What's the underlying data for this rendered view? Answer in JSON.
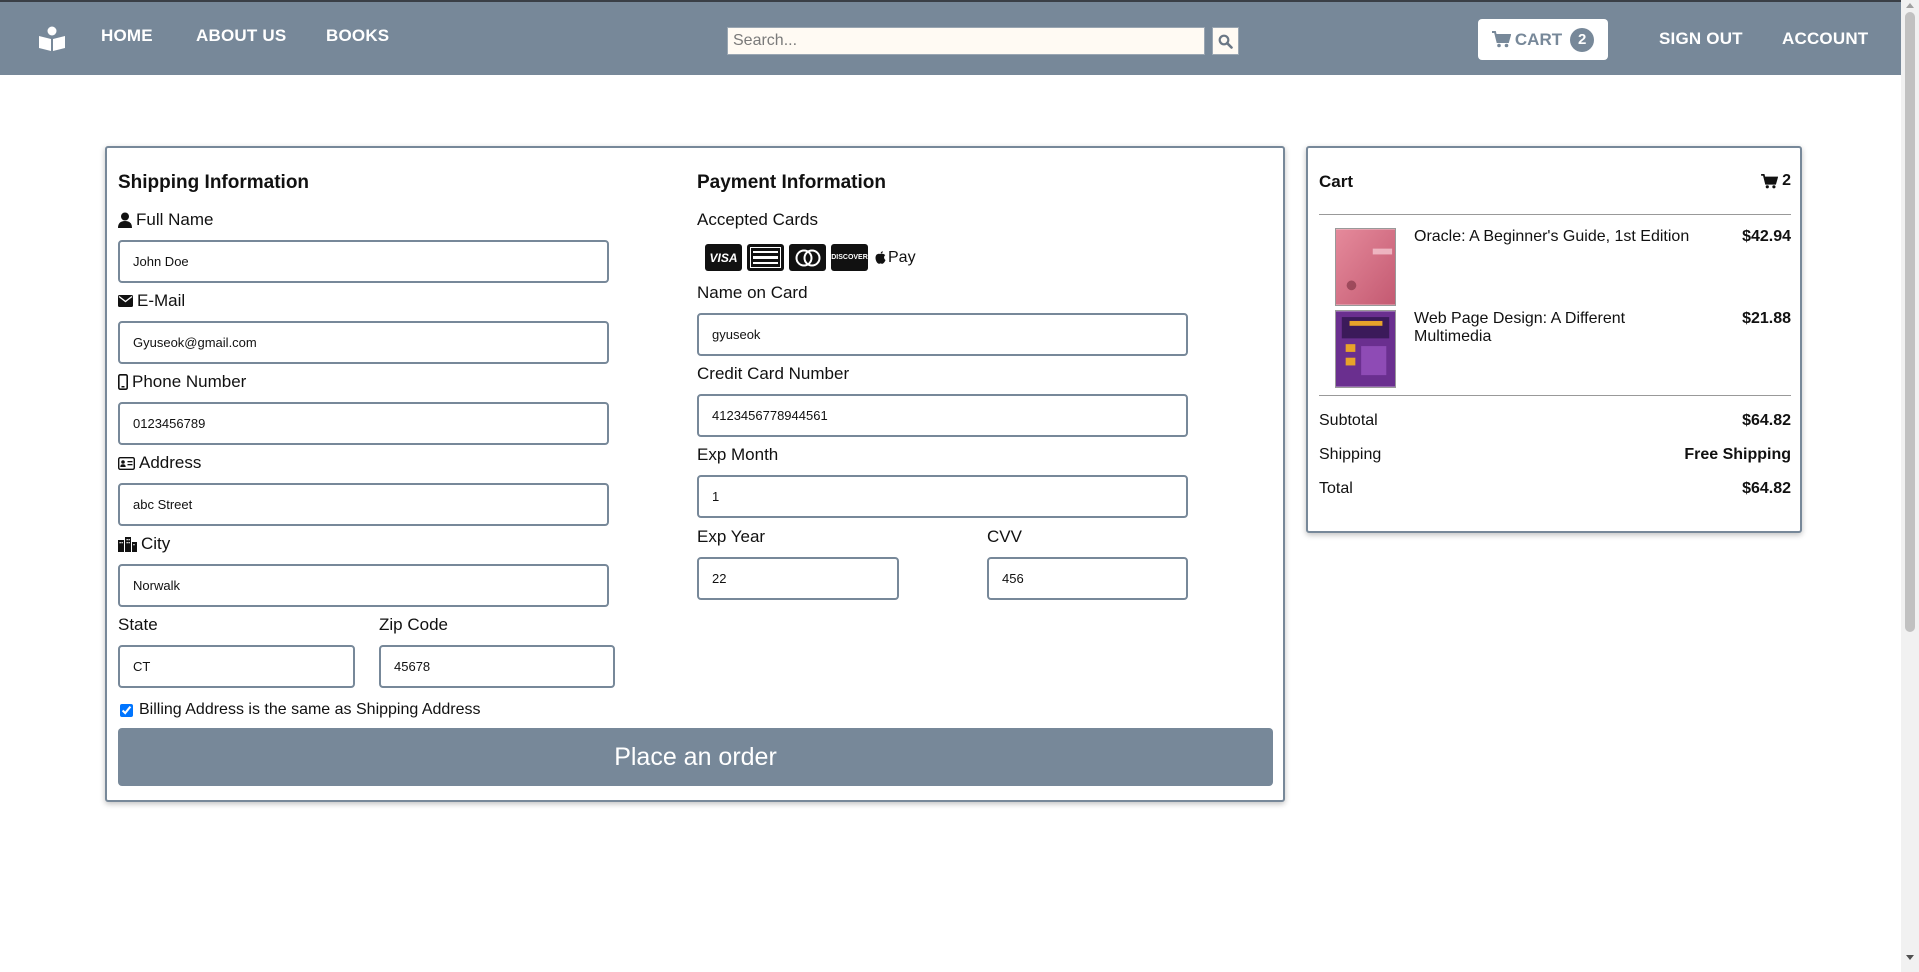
{
  "nav": {
    "home": "HOME",
    "about": "ABOUT US",
    "books": "BOOKS",
    "search_placeholder": "Search...",
    "cart_label": "CART",
    "cart_count": "2",
    "sign_out": "SIGN OUT",
    "account": "ACCOUNT"
  },
  "shipping": {
    "title": "Shipping Information",
    "full_name_label": "Full Name",
    "full_name_value": "John Doe",
    "email_label": "E-Mail",
    "email_value": "Gyuseok@gmail.com",
    "phone_label": "Phone Number",
    "phone_value": "0123456789",
    "address_label": "Address",
    "address_value": "abc Street",
    "city_label": "City",
    "city_value": "Norwalk",
    "state_label": "State",
    "state_value": "CT",
    "zip_label": "Zip Code",
    "zip_value": "45678",
    "billing_same_label": "Billing Address is the same as Shipping Address",
    "billing_same_checked": true
  },
  "payment": {
    "title": "Payment Information",
    "accepted_cards_label": "Accepted Cards",
    "cards": [
      "VISA",
      "AMEX",
      "MASTERCARD",
      "DISCOVER"
    ],
    "apple_pay": "Pay",
    "name_on_card_label": "Name on Card",
    "name_on_card_value": "gyuseok",
    "card_number_label": "Credit Card Number",
    "card_number_value": "4123456778944561",
    "exp_month_label": "Exp Month",
    "exp_month_value": "1",
    "exp_year_label": "Exp Year",
    "exp_year_value": "22",
    "cvv_label": "CVV",
    "cvv_value": "456"
  },
  "order_button": "Place an order",
  "cart": {
    "title": "Cart",
    "count": "2",
    "items": [
      {
        "title": "Oracle: A Beginner's Guide, 1st Edition",
        "price": "$42.94"
      },
      {
        "title": "Web Page Design: A Different Multimedia",
        "price": "$21.88"
      }
    ],
    "subtotal_label": "Subtotal",
    "subtotal_value": "$64.82",
    "shipping_label": "Shipping",
    "shipping_value": "Free Shipping",
    "total_label": "Total",
    "total_value": "$64.82"
  },
  "colors": {
    "navbar": "#778899",
    "border": "#778899",
    "search_bg": "#fffaf3"
  }
}
